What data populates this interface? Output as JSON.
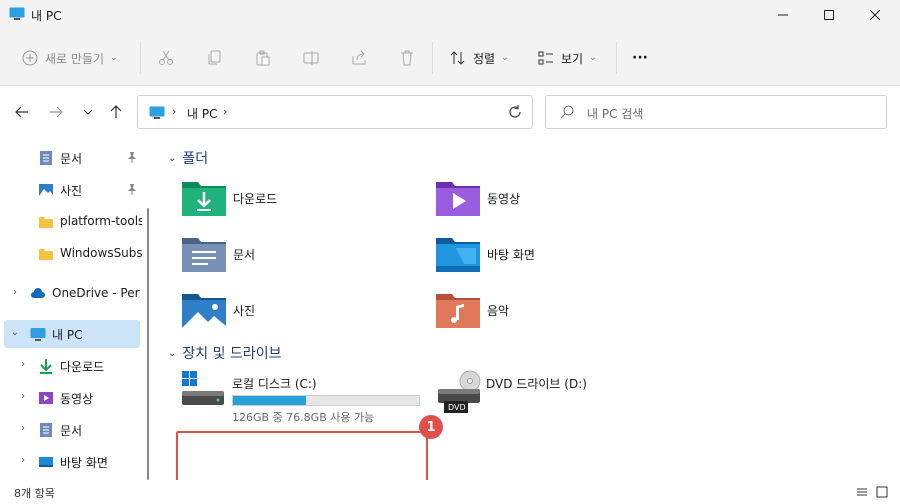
{
  "window": {
    "title": "내 PC"
  },
  "toolbar": {
    "new_label": "새로 만들기",
    "sort_label": "정렬",
    "view_label": "보기",
    "more_label": "···"
  },
  "address": {
    "crumb": "내 PC",
    "sep": "›"
  },
  "search": {
    "placeholder": "내 PC 검색"
  },
  "sidebar": {
    "items": [
      {
        "label": "문서"
      },
      {
        "label": "사진"
      },
      {
        "label": "platform-tools"
      },
      {
        "label": "WindowsSubsy"
      },
      {
        "label": "OneDrive - Perso"
      },
      {
        "label": "내 PC"
      },
      {
        "label": "다운로드"
      },
      {
        "label": "동영상"
      },
      {
        "label": "문서"
      },
      {
        "label": "바탕 화면"
      }
    ]
  },
  "content": {
    "folders_header": "폴더",
    "folders": [
      {
        "label": "다운로드"
      },
      {
        "label": "동영상"
      },
      {
        "label": "문서"
      },
      {
        "label": "바탕 화면"
      },
      {
        "label": "사진"
      },
      {
        "label": "음악"
      }
    ],
    "drives_header": "장치 및 드라이브",
    "drives": [
      {
        "label": "로컬 디스크 (C:)",
        "free_text": "126GB 중 76.8GB 사용 가능",
        "used_fraction": 0.39
      },
      {
        "label": "DVD 드라이브 (D:)",
        "badge": "DVD"
      }
    ]
  },
  "annotation": {
    "badge": "1"
  },
  "status": {
    "item_count": "8개 항목"
  },
  "colors": {
    "selection": "#cce4f7",
    "accent": "#26a0da",
    "annotation": "#e0504a"
  }
}
